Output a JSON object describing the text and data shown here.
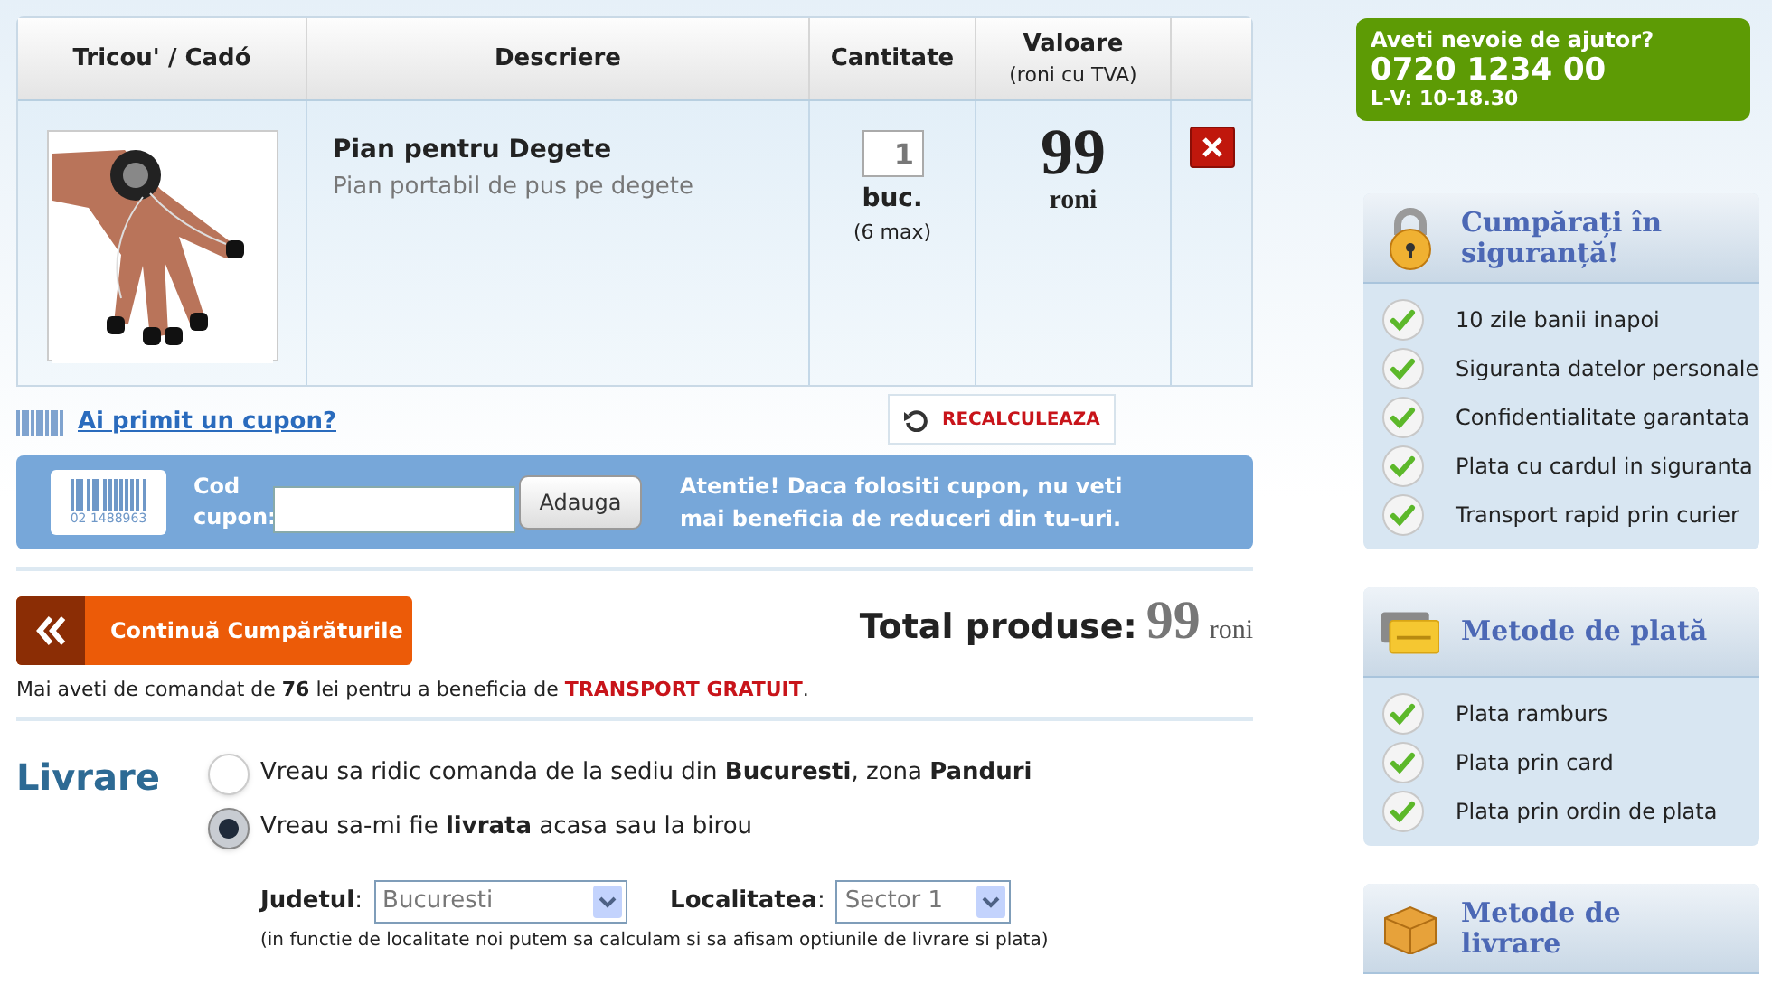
{
  "table": {
    "columns": [
      {
        "label": "Tricou' / Cadó"
      },
      {
        "label": "Descriere"
      },
      {
        "label": "Cantitate"
      },
      {
        "label": "Valoare",
        "note": "(roni cu TVA)"
      }
    ],
    "rows": [
      {
        "name": "Pian pentru Degete",
        "description": "Pian portabil de pus pe degete",
        "quantity": "1",
        "unit": "buc.",
        "max": "(6 max)",
        "price": "99",
        "currency": "roni"
      }
    ]
  },
  "coupon_link": "Ai primit un cupon?",
  "recalculate": "RECALCULEAZA",
  "coupon_bar": {
    "barcode_number": "02 1488963",
    "label": "Cod cupon:",
    "button": "Adauga",
    "warning": "Atentie! Daca folositi cupon, nu veti mai beneficia de reduceri din tu-uri."
  },
  "continue_button": "Continuă Cumpărăturile",
  "total": {
    "label": "Total produse:",
    "value": "99",
    "currency": "roni"
  },
  "free_shipping_note": [
    {
      "kind": "plain",
      "text": "Mai aveti de comandat de "
    },
    {
      "kind": "bold",
      "text": "76"
    },
    {
      "kind": "plain",
      "text": " lei pentru a beneficia de "
    },
    {
      "kind": "highlight",
      "text": "TRANSPORT GRATUIT"
    },
    {
      "kind": "plain",
      "text": "."
    }
  ],
  "delivery": {
    "title": "Livrare",
    "options": [
      {
        "label": "Vreau sa ridic comanda de la sediu din **Bucuresti**, zona **Panduri**",
        "selected": false
      },
      {
        "label": "Vreau sa-mi fie **livrata** acasa sau la birou",
        "selected": true
      }
    ],
    "county": {
      "label": "**Judetul**:",
      "value": "Bucuresti"
    },
    "locality": {
      "label": "**Localitatea**:",
      "value": "Sector 1"
    },
    "hint": "(in functie de localitate noi putem sa calculam si sa afisam optiunile de livrare si plata)"
  },
  "help": {
    "title": "Aveti nevoie de ajutor?",
    "phone": "0720 1234 00",
    "hours": "L-V: 10-18.30"
  },
  "panels": [
    {
      "kind": "lock",
      "title": "Cumpărați în siguranță!",
      "items": [
        "10 zile banii inapoi",
        "Siguranta datelor personale",
        "Confidentialitate garantata",
        "Plata cu cardul in siguranta",
        "Transport rapid prin curier"
      ]
    },
    {
      "kind": "card",
      "title": "Metode de plată",
      "items": [
        "Plata ramburs",
        "Plata prin card",
        "Plata prin ordin de plata"
      ]
    },
    {
      "kind": "box",
      "title": "Metode de livrare"
    }
  ]
}
